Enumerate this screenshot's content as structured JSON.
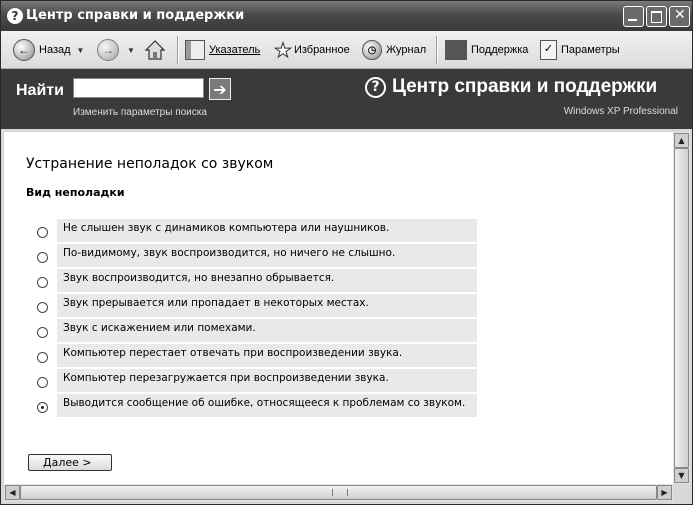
{
  "window": {
    "title": "Центр справки и поддержки",
    "buttons": {
      "minimize_icon": "minimize-icon",
      "maximize_icon": "maximize-icon",
      "close_icon": "close-icon"
    }
  },
  "toolbar": {
    "back_label": "Назад",
    "forward_icon": "forward-arrow-icon",
    "home_icon": "home-icon",
    "index_label": "Указатель",
    "favorites_label": "Избранное",
    "history_label": "Журнал",
    "support_label": "Поддержка",
    "options_label": "Параметры"
  },
  "search": {
    "label": "Найти",
    "value": "",
    "go_glyph": "➔",
    "options_link": "Изменить параметры поиска"
  },
  "header": {
    "title": "Центр справки и поддержки",
    "edition": "Windows XP Professional"
  },
  "main": {
    "title": "Устранение неполадок со звуком",
    "subtitle": "Вид неполадки",
    "options": [
      {
        "label": "Не слышен звук с динамиков компьютера или наушников.",
        "selected": false
      },
      {
        "label": "По-видимому, звук воспроизводится, но ничего не слышно.",
        "selected": false
      },
      {
        "label": "Звук воспроизводится, но внезапно обрывается.",
        "selected": false
      },
      {
        "label": "Звук прерывается или пропадает в некоторых местах.",
        "selected": false
      },
      {
        "label": "Звук с искажением или помехами.",
        "selected": false
      },
      {
        "label": "Компьютер перестает отвечать при воспроизведении звука.",
        "selected": false
      },
      {
        "label": "Компьютер перезагружается при воспроизведении звука.",
        "selected": false
      },
      {
        "label": "Выводится сообщение об ошибке, относящееся к проблемам со звуком.",
        "selected": true
      }
    ],
    "next_label": "Далее  >"
  }
}
